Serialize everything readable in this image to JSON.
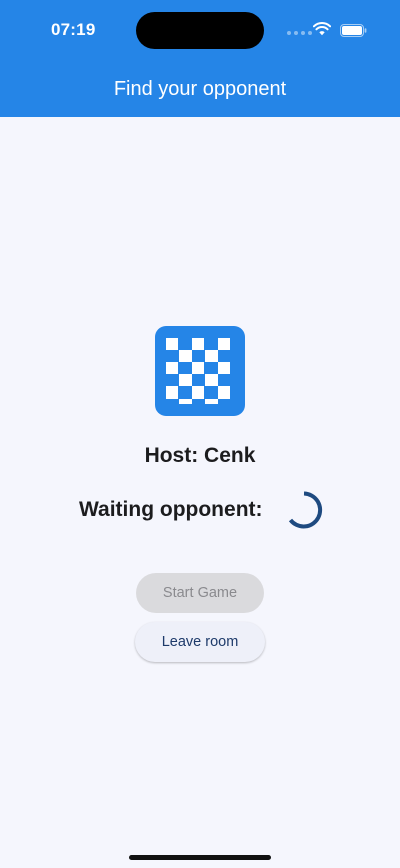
{
  "status_bar": {
    "time": "07:19",
    "icons": [
      "signal-dots-icon",
      "wifi-icon",
      "battery-icon"
    ]
  },
  "header": {
    "title": "Find your opponent"
  },
  "lobby": {
    "board_icon": "checkerboard-icon",
    "host_text": "Host: Cenk",
    "waiting_text": "Waiting opponent:",
    "spinner_icon": "loading-spinner-icon"
  },
  "actions": {
    "start_label": "Start Game",
    "start_enabled": false,
    "leave_label": "Leave room"
  },
  "colors": {
    "primary": "#2585e7",
    "background": "#f5f6fd",
    "spinner": "#1e4a80",
    "disabled_button": "#dadadd",
    "leave_button_text": "#1d3a6a"
  }
}
